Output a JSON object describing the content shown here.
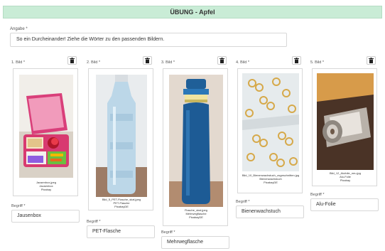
{
  "header": {
    "title": "ÜBUNG - Apfel"
  },
  "prompt": {
    "label": "Angabe *",
    "value": "So ein Durcheinander! Ziehe die Wörter zu den passenden Bildern."
  },
  "columns": [
    {
      "title": "1. Bild *",
      "icon": "trash-icon",
      "caption": [
        "Jausenbox.jpeg",
        "Jausenbox",
        "Pixabay"
      ],
      "term_label": "Begriff *",
      "term_value": "Jausenbox"
    },
    {
      "title": "2. Bild *",
      "icon": "trash-icon",
      "caption": [
        "Bild_5_PET-Flasche_skal.jpeg",
        "PET-Flasche",
        "PixabayDE"
      ],
      "term_label": "Begriff *",
      "term_value": "PET-Flasche"
    },
    {
      "title": "3. Bild *",
      "icon": "trash-icon",
      "caption": [
        "Flasche_skal.jpeg",
        "Mehrwegflasche",
        "PixabayDE"
      ],
      "term_label": "Begriff *",
      "term_value": "Mehrwegflasche"
    },
    {
      "title": "4. Bild *",
      "icon": "trash-icon",
      "caption": [
        "Bild_10_Bienenwachstuch_zugeschnitten.jpg",
        "Bienenwachstuch",
        "PixabayDE"
      ],
      "term_label": "Begriff *",
      "term_value": "Bienenwachstuch"
    },
    {
      "title": "5. Bild *",
      "icon": "trash-icon",
      "caption": [
        "Bild_12_Alufolie_neu.jpg",
        "Alu-Folie",
        "Pixabay"
      ],
      "term_label": "Begriff *",
      "term_value": "Alu-Folie"
    }
  ],
  "colors": {
    "header_bg": "#c9ecd6",
    "border": "#d7d7d7"
  }
}
